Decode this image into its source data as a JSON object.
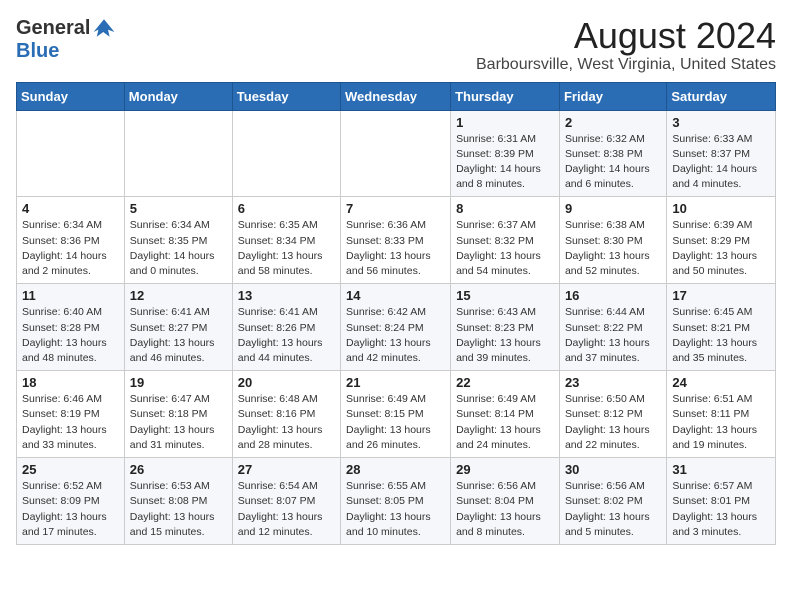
{
  "logo": {
    "general": "General",
    "blue": "Blue"
  },
  "title": "August 2024",
  "subtitle": "Barboursville, West Virginia, United States",
  "days_of_week": [
    "Sunday",
    "Monday",
    "Tuesday",
    "Wednesday",
    "Thursday",
    "Friday",
    "Saturday"
  ],
  "weeks": [
    [
      {
        "day": "",
        "info": ""
      },
      {
        "day": "",
        "info": ""
      },
      {
        "day": "",
        "info": ""
      },
      {
        "day": "",
        "info": ""
      },
      {
        "day": "1",
        "info": "Sunrise: 6:31 AM\nSunset: 8:39 PM\nDaylight: 14 hours\nand 8 minutes."
      },
      {
        "day": "2",
        "info": "Sunrise: 6:32 AM\nSunset: 8:38 PM\nDaylight: 14 hours\nand 6 minutes."
      },
      {
        "day": "3",
        "info": "Sunrise: 6:33 AM\nSunset: 8:37 PM\nDaylight: 14 hours\nand 4 minutes."
      }
    ],
    [
      {
        "day": "4",
        "info": "Sunrise: 6:34 AM\nSunset: 8:36 PM\nDaylight: 14 hours\nand 2 minutes."
      },
      {
        "day": "5",
        "info": "Sunrise: 6:34 AM\nSunset: 8:35 PM\nDaylight: 14 hours\nand 0 minutes."
      },
      {
        "day": "6",
        "info": "Sunrise: 6:35 AM\nSunset: 8:34 PM\nDaylight: 13 hours\nand 58 minutes."
      },
      {
        "day": "7",
        "info": "Sunrise: 6:36 AM\nSunset: 8:33 PM\nDaylight: 13 hours\nand 56 minutes."
      },
      {
        "day": "8",
        "info": "Sunrise: 6:37 AM\nSunset: 8:32 PM\nDaylight: 13 hours\nand 54 minutes."
      },
      {
        "day": "9",
        "info": "Sunrise: 6:38 AM\nSunset: 8:30 PM\nDaylight: 13 hours\nand 52 minutes."
      },
      {
        "day": "10",
        "info": "Sunrise: 6:39 AM\nSunset: 8:29 PM\nDaylight: 13 hours\nand 50 minutes."
      }
    ],
    [
      {
        "day": "11",
        "info": "Sunrise: 6:40 AM\nSunset: 8:28 PM\nDaylight: 13 hours\nand 48 minutes."
      },
      {
        "day": "12",
        "info": "Sunrise: 6:41 AM\nSunset: 8:27 PM\nDaylight: 13 hours\nand 46 minutes."
      },
      {
        "day": "13",
        "info": "Sunrise: 6:41 AM\nSunset: 8:26 PM\nDaylight: 13 hours\nand 44 minutes."
      },
      {
        "day": "14",
        "info": "Sunrise: 6:42 AM\nSunset: 8:24 PM\nDaylight: 13 hours\nand 42 minutes."
      },
      {
        "day": "15",
        "info": "Sunrise: 6:43 AM\nSunset: 8:23 PM\nDaylight: 13 hours\nand 39 minutes."
      },
      {
        "day": "16",
        "info": "Sunrise: 6:44 AM\nSunset: 8:22 PM\nDaylight: 13 hours\nand 37 minutes."
      },
      {
        "day": "17",
        "info": "Sunrise: 6:45 AM\nSunset: 8:21 PM\nDaylight: 13 hours\nand 35 minutes."
      }
    ],
    [
      {
        "day": "18",
        "info": "Sunrise: 6:46 AM\nSunset: 8:19 PM\nDaylight: 13 hours\nand 33 minutes."
      },
      {
        "day": "19",
        "info": "Sunrise: 6:47 AM\nSunset: 8:18 PM\nDaylight: 13 hours\nand 31 minutes."
      },
      {
        "day": "20",
        "info": "Sunrise: 6:48 AM\nSunset: 8:16 PM\nDaylight: 13 hours\nand 28 minutes."
      },
      {
        "day": "21",
        "info": "Sunrise: 6:49 AM\nSunset: 8:15 PM\nDaylight: 13 hours\nand 26 minutes."
      },
      {
        "day": "22",
        "info": "Sunrise: 6:49 AM\nSunset: 8:14 PM\nDaylight: 13 hours\nand 24 minutes."
      },
      {
        "day": "23",
        "info": "Sunrise: 6:50 AM\nSunset: 8:12 PM\nDaylight: 13 hours\nand 22 minutes."
      },
      {
        "day": "24",
        "info": "Sunrise: 6:51 AM\nSunset: 8:11 PM\nDaylight: 13 hours\nand 19 minutes."
      }
    ],
    [
      {
        "day": "25",
        "info": "Sunrise: 6:52 AM\nSunset: 8:09 PM\nDaylight: 13 hours\nand 17 minutes."
      },
      {
        "day": "26",
        "info": "Sunrise: 6:53 AM\nSunset: 8:08 PM\nDaylight: 13 hours\nand 15 minutes."
      },
      {
        "day": "27",
        "info": "Sunrise: 6:54 AM\nSunset: 8:07 PM\nDaylight: 13 hours\nand 12 minutes."
      },
      {
        "day": "28",
        "info": "Sunrise: 6:55 AM\nSunset: 8:05 PM\nDaylight: 13 hours\nand 10 minutes."
      },
      {
        "day": "29",
        "info": "Sunrise: 6:56 AM\nSunset: 8:04 PM\nDaylight: 13 hours\nand 8 minutes."
      },
      {
        "day": "30",
        "info": "Sunrise: 6:56 AM\nSunset: 8:02 PM\nDaylight: 13 hours\nand 5 minutes."
      },
      {
        "day": "31",
        "info": "Sunrise: 6:57 AM\nSunset: 8:01 PM\nDaylight: 13 hours\nand 3 minutes."
      }
    ]
  ]
}
